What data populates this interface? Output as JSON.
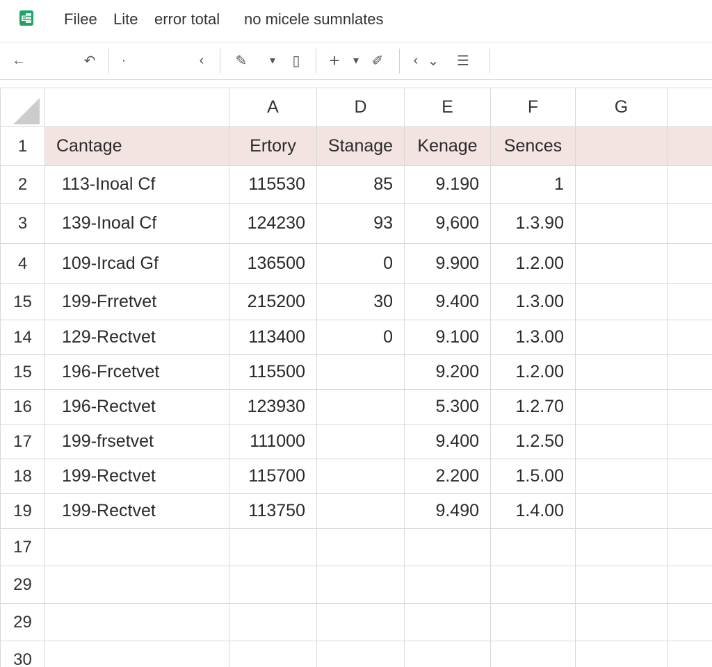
{
  "menu": {
    "items": [
      "Filee",
      "Lite",
      "error total",
      "no micele sumnlates"
    ]
  },
  "toolbar": {
    "icons": [
      "back-arrow-icon",
      "undo-icon",
      "dot-icon",
      "close-x-icon",
      "paint-icon",
      "dropdown-icon",
      "clipboard-icon",
      "plus-icon",
      "dropdown-icon",
      "pen-icon",
      "redo-icon",
      "chevron-down-icon",
      "filter-icon"
    ],
    "glyphs": {
      "back": "←",
      "undo": "↶",
      "dot": "·",
      "close": "‹",
      "paint": "✎",
      "drop": "▾",
      "clip": "▯",
      "plus": "+",
      "pen": "✐",
      "redo": "‹",
      "chev": "⌄",
      "filter": "☰"
    }
  },
  "sheet": {
    "column_headers": [
      "",
      "A",
      "D",
      "E",
      "F",
      "G",
      ""
    ],
    "header_row": {
      "row_num": "1",
      "cells": [
        "Cantage",
        "Ertory",
        "Stanage",
        "Kenage",
        "Sences"
      ]
    },
    "rows": [
      {
        "row_num": "2",
        "cells": [
          "113-Inoal Cf",
          "115530",
          "85",
          "9.190",
          "1"
        ]
      },
      {
        "row_num": "3",
        "cells": [
          "139-Inoal Cf",
          "124230",
          "93",
          "9,600",
          "1.3.90"
        ]
      },
      {
        "row_num": "4",
        "cells": [
          "109-Ircad Gf",
          "136500",
          "0",
          "9.900",
          "1.2.00"
        ]
      },
      {
        "row_num": "15",
        "cells": [
          "199-Frretvet",
          "215200",
          "30",
          "9.400",
          "1.3.00"
        ]
      },
      {
        "row_num": "14",
        "cells": [
          "129-Rectvet",
          "113400",
          "0",
          "9.100",
          "1.3.00"
        ]
      },
      {
        "row_num": "15",
        "cells": [
          "196-Frcetvet",
          "115500",
          "",
          "9.200",
          "1.2.00"
        ]
      },
      {
        "row_num": "16",
        "cells": [
          "196-Rectvet",
          "123930",
          "",
          "5.300",
          "1.2.70"
        ]
      },
      {
        "row_num": "17",
        "cells": [
          "199-frsetvet",
          "111000",
          "",
          "9.400",
          "1.2.50"
        ]
      },
      {
        "row_num": "18",
        "cells": [
          "199-Rectvet",
          "115700",
          "",
          "2.200",
          "1.5.00"
        ]
      },
      {
        "row_num": "19",
        "cells": [
          "199-Rectvet",
          "113750",
          "",
          "9.490",
          "1.4.00"
        ]
      }
    ],
    "empty_rows": [
      "17",
      "29",
      "29",
      "30"
    ]
  },
  "colors": {
    "header_fill": "#f3e4e2",
    "logo_green": "#21a366",
    "gridline": "#d8d8d8"
  }
}
